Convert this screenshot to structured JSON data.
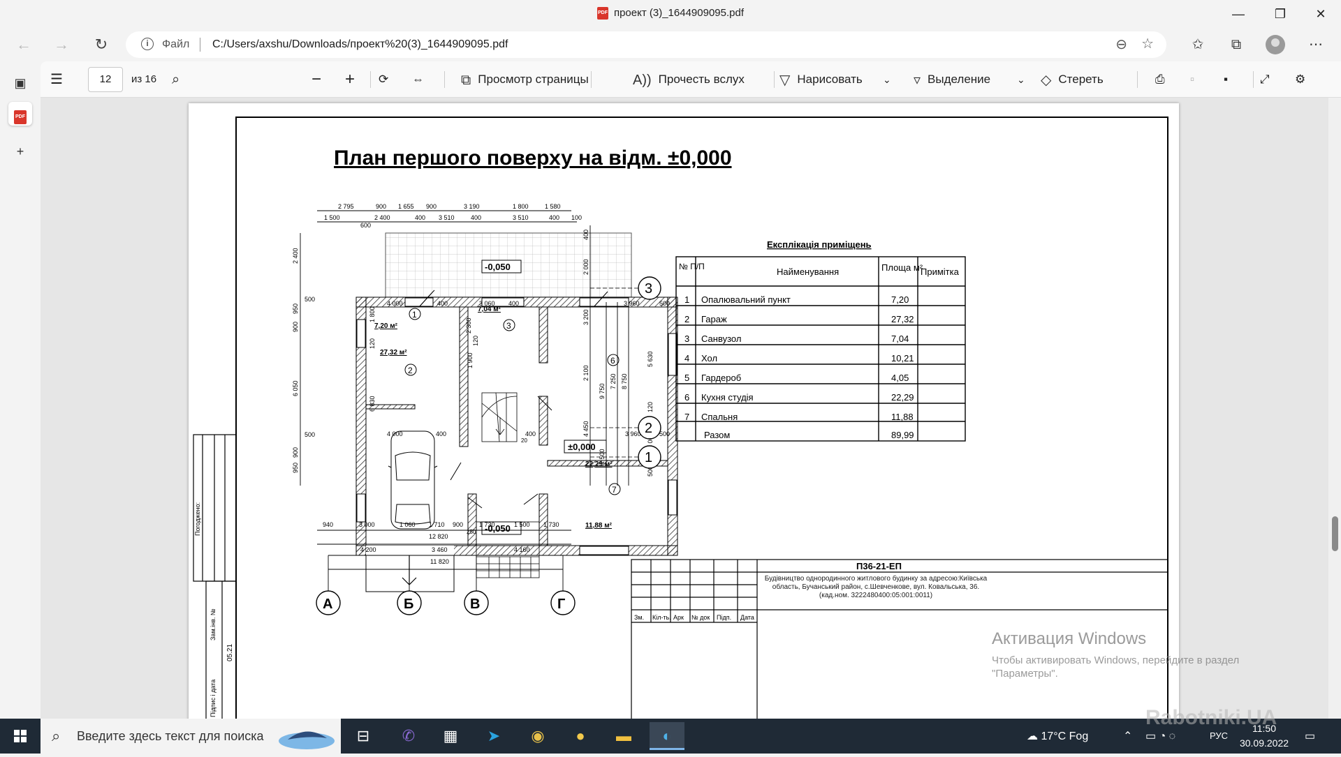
{
  "window": {
    "title": "проект (3)_1644909095.pdf",
    "minimize": "—",
    "maximize": "❐",
    "close": "✕"
  },
  "addressbar": {
    "file_label": "Файл",
    "url": "C:/Users/axshu/Downloads/проект%20(3)_1644909095.pdf"
  },
  "pdf_toolbar": {
    "page_current": "12",
    "page_total": "из 16",
    "page_view": "Просмотр страницы",
    "read_aloud": "Прочесть вслух",
    "draw": "Нарисовать",
    "highlight": "Выделение",
    "erase": "Стереть"
  },
  "drawing": {
    "title": "План першого поверху на відм.  ±0,000",
    "levels": [
      "-0,050",
      "±0,000",
      "-0,050"
    ],
    "axes_letters": [
      "А",
      "Б",
      "В",
      "Г"
    ],
    "axes_numbers": [
      "3",
      "2",
      "1"
    ],
    "room_marks": [
      "1",
      "2",
      "3",
      "6",
      "7"
    ],
    "room_areas": [
      "7,20 м²",
      "27,32 м²",
      "7,04 м²",
      "22,29 м²",
      "11,88 м²"
    ],
    "top_dims_1": [
      "2 795",
      "900",
      "1 655",
      "900",
      "3 190",
      "1 800",
      "1 580"
    ],
    "top_dims_2": [
      "1 500",
      "2 400",
      "400",
      "3 510",
      "400",
      "3 510",
      "400",
      "100"
    ],
    "top_dims_600": "600",
    "inner_top": [
      "4 000",
      "400",
      "3 060",
      "400",
      "3 960",
      "500"
    ],
    "inner_mid": [
      "4 000",
      "400",
      "400",
      "3 960",
      "500"
    ],
    "bottom_dims_1": [
      "940",
      "3 000",
      "1 060",
      "1 710",
      "900",
      "1 730",
      "1 500",
      "1 730"
    ],
    "bottom_250": "250",
    "bottom_total_1": "12 820",
    "bottom_dims_2": [
      "4 200",
      "3 460",
      "4 160"
    ],
    "bottom_total_2": "11 820",
    "left_dims": [
      "2 400",
      "500",
      "950",
      "900",
      "6 050",
      "500",
      "950",
      "900"
    ],
    "inner_dims": [
      "1 800",
      "120",
      "6 830",
      "2 300",
      "120",
      "1 900",
      "5 630",
      "120",
      "3 000",
      "500"
    ],
    "right_dims": [
      "400",
      "2 000",
      "3 200",
      "2 100",
      "4 450",
      "1 500",
      "9 750",
      "7 250",
      "8 750"
    ],
    "small_20": "20"
  },
  "explication": {
    "title": "Експлікація приміщень",
    "headers": [
      "№ П/П",
      "Найменування",
      "Площа м²",
      "Примітка"
    ],
    "rows": [
      [
        "1",
        "Опалювальний пункт",
        "7,20",
        ""
      ],
      [
        "2",
        "Гараж",
        "27,32",
        ""
      ],
      [
        "3",
        "Санвузол",
        "7,04",
        ""
      ],
      [
        "4",
        "Хол",
        "10,21",
        ""
      ],
      [
        "5",
        "Гардероб",
        "4,05",
        ""
      ],
      [
        "6",
        "Кухня студія",
        "22,29",
        ""
      ],
      [
        "7",
        "Спальня",
        "11,88",
        ""
      ],
      [
        "",
        "Разом",
        "89,99",
        ""
      ]
    ]
  },
  "stamp": {
    "code": "П36-21-ЕП",
    "description": "Будівництво однородинного житлового будинку за адресою:Київська область, Бучанський район, с.Шевченкове,  вул. Ковальська, 36. (кад.ном. 3222480400:05:001:0011)",
    "cols": [
      "Зм.",
      "Кіл-ть.",
      "Арк",
      "№ док",
      "Підп.",
      "Дата"
    ],
    "side_labels": [
      "Погоджено:",
      "Зам.інв. №",
      "Підпис і дата",
      "05.21"
    ]
  },
  "activation": {
    "line1": "Активация Windows",
    "line2": "Чтобы активировать Windows, перейдите в раздел",
    "line3": "\"Параметры\"."
  },
  "taskbar": {
    "search_placeholder": "Введите здесь текст для поиска",
    "weather": "17°C  Fog",
    "lang": "РУС",
    "time": "11:50",
    "date": "30.09.2022"
  },
  "watermark": "Rabotniki.UA",
  "colors": {
    "pdf_red": "#d9362b",
    "taskbar": "#1f2a36",
    "hatch": "#333333"
  }
}
